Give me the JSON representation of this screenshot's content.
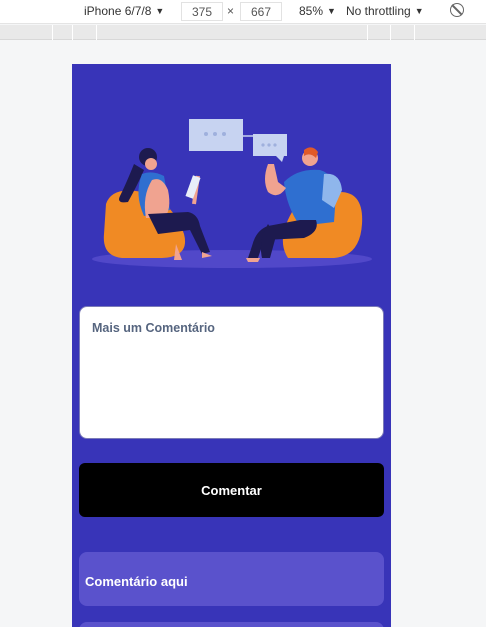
{
  "devtools": {
    "device": "iPhone 6/7/8",
    "width": "375",
    "times": "×",
    "height": "667",
    "zoom": "85%",
    "throttling": "No throttling",
    "caret": "▼"
  },
  "app": {
    "comment_placeholder": "Mais um Comentário",
    "comment_button": "Comentar",
    "comments": [
      "Comentário aqui",
      ""
    ]
  },
  "colors": {
    "background": "#3834b8",
    "card": "#5a52cc",
    "button": "#000000"
  }
}
